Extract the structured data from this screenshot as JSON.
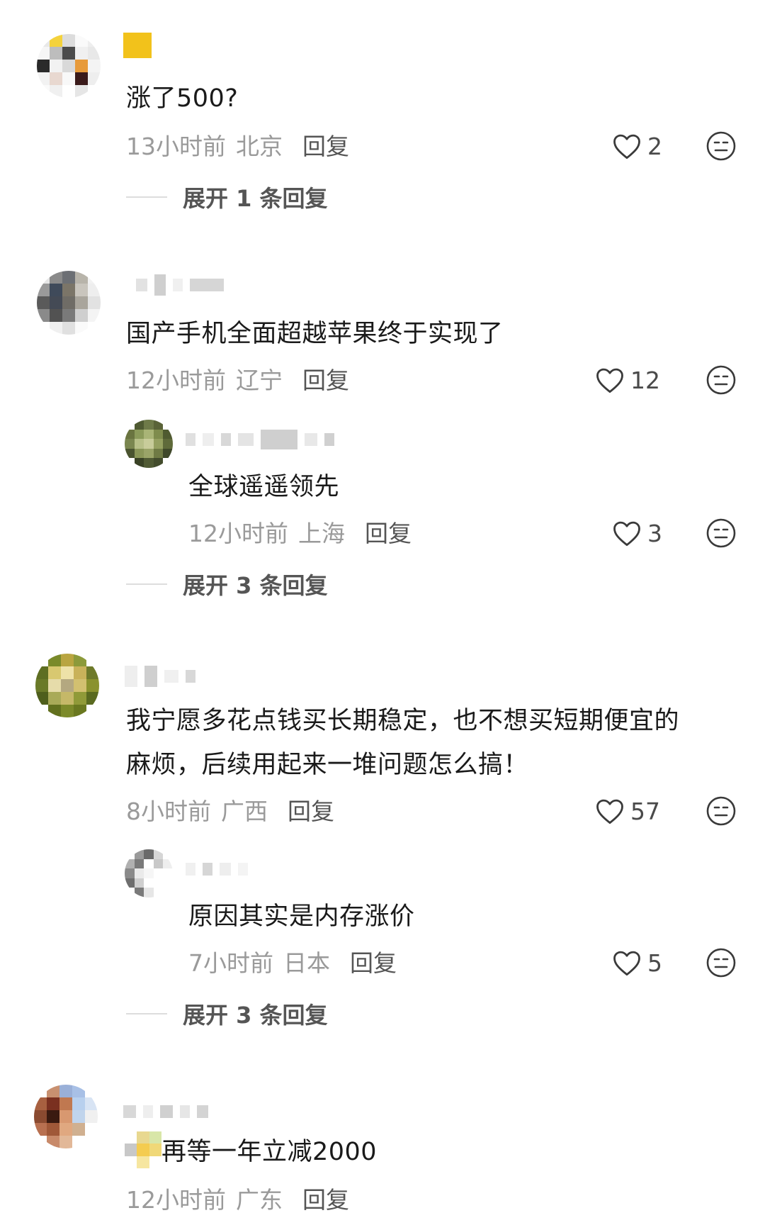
{
  "colors": {
    "text_primary": "#1a1a1a",
    "text_meta": "#9a9a9a",
    "text_secondary": "#555555",
    "background": "#ffffff"
  },
  "icons": {
    "like": "heart-outline-icon",
    "dislike": "neutral-face-icon"
  },
  "comments": [
    {
      "text": "涨了500?",
      "time": "13小时前",
      "location": "北京",
      "reply_label": "回复",
      "likes": "2",
      "expand_label": "展开 1 条回复"
    },
    {
      "text": "国产手机全面超越苹果终于实现了",
      "time": "12小时前",
      "location": "辽宁",
      "reply_label": "回复",
      "likes": "12",
      "reply": {
        "text": "全球遥遥领先",
        "time": "12小时前",
        "location": "上海",
        "reply_label": "回复",
        "likes": "3"
      },
      "expand_label": "展开 3 条回复"
    },
    {
      "text_line1": "我宁愿多花点钱买长期稳定，也不想买短期便宜的",
      "text_line2": "麻烦，后续用起来一堆问题怎么搞！",
      "time": "8小时前",
      "location": "广西",
      "reply_label": "回复",
      "likes": "57",
      "reply": {
        "text": "原因其实是内存涨价",
        "time": "7小时前",
        "location": "日本",
        "reply_label": "回复",
        "likes": "5"
      },
      "expand_label": "展开 3 条回复"
    },
    {
      "text": "再等一年立减2000",
      "time": "12小时前",
      "location": "广东",
      "reply_label": "回复"
    }
  ]
}
